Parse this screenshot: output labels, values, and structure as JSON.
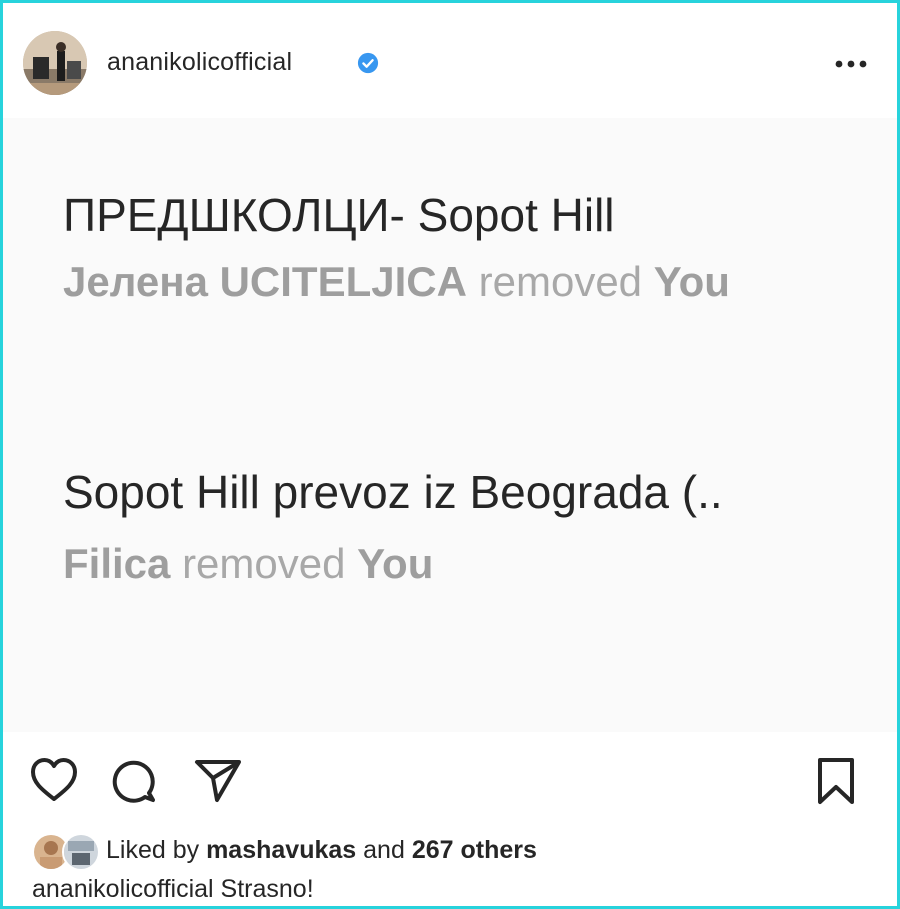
{
  "header": {
    "username": "ananikolicofficial"
  },
  "post": {
    "groups": [
      {
        "title": "ПРЕДШКОЛЦИ- Sopot Hill",
        "actor": "Јелена UCITELJICA",
        "action": "removed",
        "target": "You"
      },
      {
        "title": "Sopot Hill prevoz iz Beograda (..",
        "actor": "Filica",
        "action": "removed",
        "target": "You"
      }
    ]
  },
  "likes": {
    "prefix": "Liked by",
    "user": "mashavukas",
    "middle": "and",
    "count": "267 others"
  },
  "caption": {
    "username": "ananikolicofficial",
    "text": "Strasno!"
  },
  "colors": {
    "verified": "#3897f0",
    "frame": "#27d3dc",
    "post_bg": "#fafafa",
    "removed_text": "#a8a8a8"
  }
}
